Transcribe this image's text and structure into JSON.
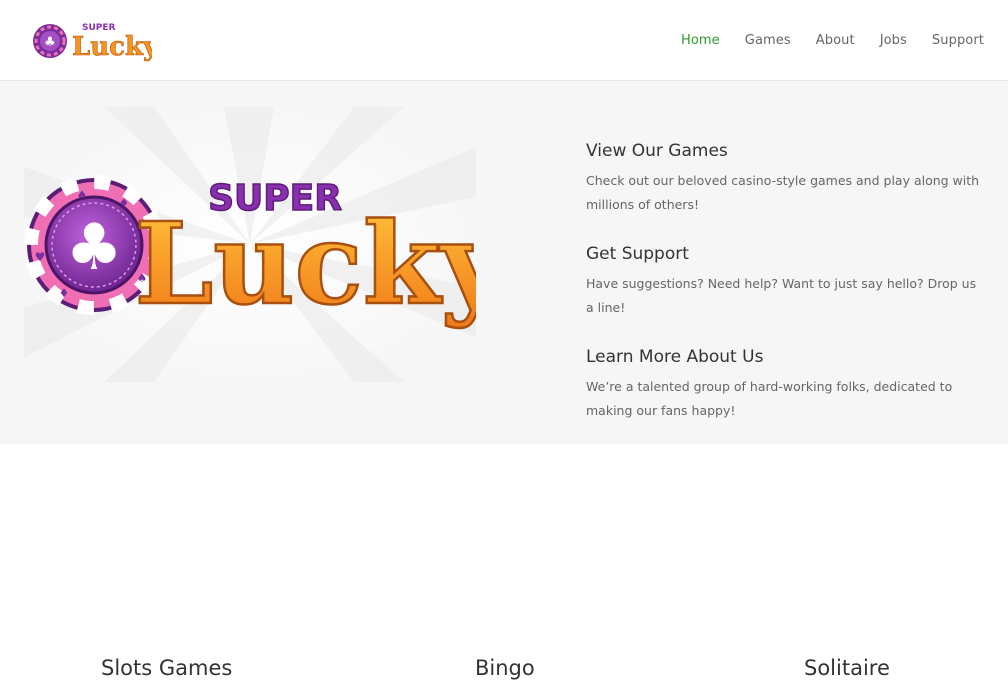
{
  "header": {
    "logo_top_text": "SUPER",
    "logo_main_text": "Lucky",
    "nav": [
      {
        "label": "Home",
        "active": true
      },
      {
        "label": "Games",
        "active": false
      },
      {
        "label": "About",
        "active": false
      },
      {
        "label": "Jobs",
        "active": false
      },
      {
        "label": "Support",
        "active": false
      }
    ]
  },
  "hero": {
    "logo_top_text": "SUPER",
    "logo_main_text": "Lucky",
    "features": [
      {
        "title": "View Our Games",
        "text": "Check out our beloved casino-style games and play along with millions of others!"
      },
      {
        "title": "Get Support",
        "text": "Have suggestions? Need help? Want to just say hello? Drop us a line!"
      },
      {
        "title": "Learn More About Us",
        "text": "We’re a talented group of hard-working folks, dedicated to making our fans happy!"
      }
    ]
  },
  "games": [
    {
      "title": "Slots Games"
    },
    {
      "title": "Bingo"
    },
    {
      "title": "Solitaire"
    }
  ],
  "colors": {
    "nav_active": "#2e9a2e",
    "chip_purple": "#7a2d9c",
    "chip_pink": "#f06fb4",
    "logo_orange": "#f7941d",
    "hero_bg": "#f6f6f6"
  }
}
